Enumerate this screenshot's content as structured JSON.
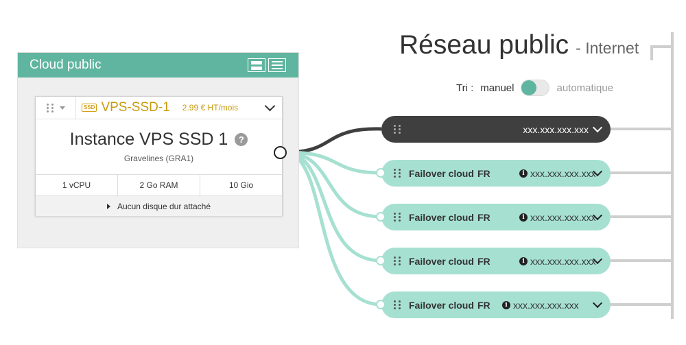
{
  "cloud": {
    "title": "Cloud public",
    "instance": {
      "ssd_badge": "SSD",
      "flavor": "VPS-SSD-1",
      "price": "2.99 € HT/mois",
      "name": "Instance VPS SSD 1",
      "help_icon": "?",
      "location": "Gravelines (GRA1)",
      "specs": [
        "1 vCPU",
        "2 Go RAM",
        "10 Gio"
      ],
      "disk_label": "Aucun disque dur attaché"
    }
  },
  "network": {
    "title": "Réseau public",
    "subtitle": "- Internet",
    "sort": {
      "label": "Tri :",
      "manual": "manuel",
      "automatic": "automatique"
    },
    "public_ip": "xxx.xxx.xxx.xxx",
    "failovers": [
      {
        "name": "Failover cloud",
        "country": "FR",
        "ip": "xxx.xxx.xxx.xxx"
      },
      {
        "name": "Failover cloud",
        "country": "FR",
        "ip": "xxx.xxx.xxx.xxx"
      },
      {
        "name": "Failover cloud",
        "country": "FR",
        "ip": "xxx.xxx.xxx.xxx"
      },
      {
        "name": "Failover cloud",
        "country": "FR",
        "ip": "xxx.xxx.xxx.xxx"
      }
    ]
  },
  "colors": {
    "accent": "#5fb5a0",
    "failover": "#a6e0d1",
    "public_pill": "#3f3f3f",
    "flavor": "#c89b0e"
  }
}
